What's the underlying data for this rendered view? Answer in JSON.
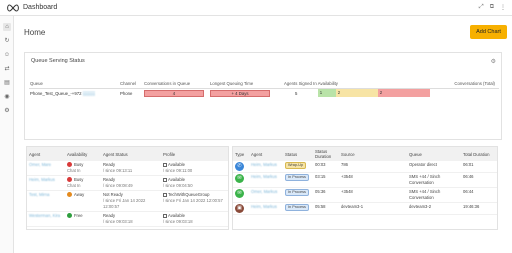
{
  "app": {
    "title": "Dashboard"
  },
  "page": {
    "title": "Home",
    "add_chart_label": "Add Chart"
  },
  "queue_serving": {
    "title": "Queue Serving Status",
    "columns": [
      "Queue",
      "Channel",
      "Conversations in Queue",
      "Longest Queuing Time",
      "Agents Signed In",
      "Availability",
      "Conversations (Total)"
    ],
    "row": {
      "queue": "Phone_Test_Queue_-+972",
      "channel": "Phone",
      "in_queue": "4",
      "longest": "+ 4 Days",
      "signed_in": "5",
      "availability": [
        "1",
        "2",
        "2"
      ]
    }
  },
  "agents": {
    "columns": [
      "Agent",
      "Availability",
      "Agent Status",
      "Profile"
    ],
    "rows": [
      {
        "agent": "Omer, Mare",
        "avail": "Busy",
        "avail_sub": "Chat In",
        "dot": "#d93a3a",
        "status": "Ready",
        "status_sub": "/ since 09:13:11",
        "profile": "Available",
        "profile_sub": "/ since 09:11:00"
      },
      {
        "agent": "Heim, Markus",
        "avail": "Busy",
        "avail_sub": "Chat In",
        "dot": "#d93a3a",
        "status": "Ready",
        "status_sub": "/ since 09:08:49",
        "profile": "Available",
        "profile_sub": "/ since 09:04:50"
      },
      {
        "agent": "Test, Mirna",
        "avail": "Away",
        "avail_sub": "",
        "dot": "#e48a1e",
        "status": "Not Ready",
        "status_sub": "/ since Fri Jan 14 2022 12:00:57",
        "profile": "TechWithQueueGroup",
        "profile_sub": "/ since Fri Jan 14 2022 12:00:57"
      },
      {
        "agent": "Westerman, Kira",
        "avail": "Free",
        "avail_sub": "",
        "dot": "#2e9e3e",
        "status": "Ready",
        "status_sub": "/ since 09:03:18",
        "profile": "Available",
        "profile_sub": "/ since 09:03:18"
      }
    ]
  },
  "conversations": {
    "columns": [
      "Type",
      "Agent",
      "Status",
      "Status Duration",
      "Source",
      "Queue",
      "Total Duration"
    ],
    "rows": [
      {
        "type_icon": "phone-icon",
        "color": "#3a86d8",
        "agent": "Heim, Markus",
        "status": "Wrap-Up",
        "badge": "wrap",
        "duration": "00:03",
        "source": "786",
        "queue": "Operator direct",
        "total": "06:01"
      },
      {
        "type_icon": "sms-icon",
        "color": "#3bb34a",
        "agent": "Heim, Markus",
        "status": "In Process",
        "badge": "proc",
        "duration": "03:15",
        "source": "+3548",
        "queue": "SMS +44 / Sinch Conversation",
        "total": "06:46"
      },
      {
        "type_icon": "sms-icon",
        "color": "#3bb34a",
        "agent": "Omer, Markus",
        "status": "In Process",
        "badge": "proc",
        "duration": "05:36",
        "source": "+3548",
        "queue": "SMS +44 / Sinch Conversation",
        "total": "06:44"
      },
      {
        "type_icon": "chat-icon",
        "color": "#8a4b3a",
        "agent": "Heim, Markus",
        "status": "In Process",
        "badge": "proc",
        "duration": "05:58",
        "source": "devteam3-1",
        "queue": "devteam3-2",
        "total": "19:46:36"
      }
    ]
  }
}
